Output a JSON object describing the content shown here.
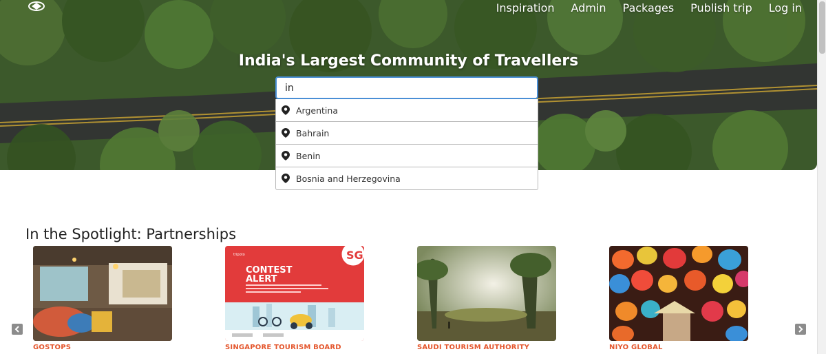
{
  "nav": {
    "items": [
      {
        "label": "Inspiration"
      },
      {
        "label": "Admin"
      },
      {
        "label": "Packages"
      },
      {
        "label": "Publish trip"
      },
      {
        "label": "Log in"
      }
    ]
  },
  "hero": {
    "title": "India's Largest Community of Travellers"
  },
  "search": {
    "value": "in",
    "suggestions": [
      {
        "label": "Argentina",
        "icon": "map-pin-icon"
      },
      {
        "label": "Bahrain",
        "icon": "map-pin-icon"
      },
      {
        "label": "Benin",
        "icon": "map-pin-icon"
      },
      {
        "label": "Bosnia and Herzegovina",
        "icon": "map-pin-icon"
      }
    ]
  },
  "spotlight": {
    "title": "In the Spotlight: Partnerships",
    "cards": [
      {
        "name": "GOSTOPS"
      },
      {
        "name": "SINGAPORE TOURISM BOARD",
        "image_text": {
          "badge": "SG",
          "brand": "tripoto",
          "headline_1": "CONTEST",
          "headline_2": "ALERT"
        }
      },
      {
        "name": "SAUDI TOURISM AUTHORITY"
      },
      {
        "name": "NIYO GLOBAL"
      }
    ]
  },
  "colors": {
    "accent": "#e4572e",
    "search_border": "#4a8fd6",
    "contest_red": "#e23b3b"
  }
}
